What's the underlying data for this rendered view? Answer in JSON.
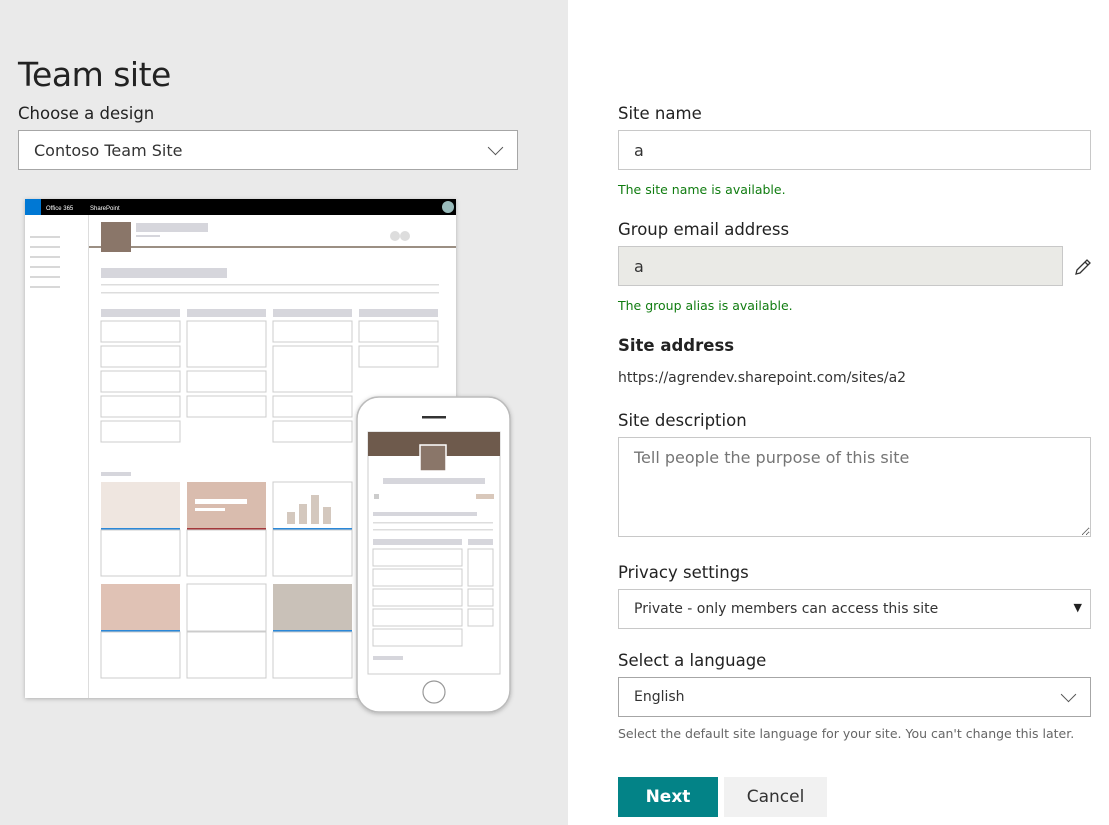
{
  "left": {
    "title": "Team site",
    "design_label": "Choose a design",
    "design_value": "Contoso Team Site",
    "preview": {
      "suite_brand": "Office 365",
      "app_name": "SharePoint"
    }
  },
  "form": {
    "site_name_label": "Site name",
    "site_name_value": "a",
    "site_name_status": "The site name is available.",
    "email_label": "Group email address",
    "email_value": "a",
    "email_status": "The group alias is available.",
    "address_label": "Site address",
    "address_value": "https://agrendev.sharepoint.com/sites/a2",
    "description_label": "Site description",
    "description_placeholder": "Tell people the purpose of this site",
    "privacy_label": "Privacy settings",
    "privacy_value": "Private - only members can access this site",
    "language_label": "Select a language",
    "language_value": "English",
    "language_help": "Select the default site language for your site. You can't change this later."
  },
  "buttons": {
    "next": "Next",
    "cancel": "Cancel"
  },
  "colors": {
    "accent": "#038387",
    "success": "#107c10",
    "left_bg": "#eaeaea"
  }
}
